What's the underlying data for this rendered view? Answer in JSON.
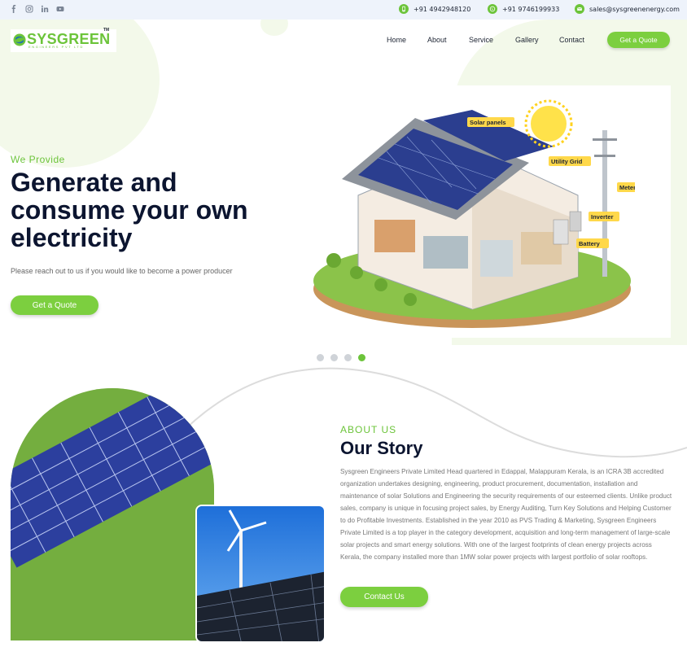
{
  "topbar": {
    "social_icons": [
      "facebook-icon",
      "instagram-icon",
      "linkedin-icon",
      "youtube-icon"
    ],
    "phone": "+91 4942948120",
    "whatsapp": "+91 9746199933",
    "email": "sales@sysgreenenergy.com"
  },
  "logo": {
    "name": "SYSGREEN",
    "tagline": "ENGINEERS PVT LTD",
    "tm": "TM"
  },
  "nav": {
    "items": [
      "Home",
      "About",
      "Service",
      "Gallery",
      "Contact"
    ],
    "cta": "Get a Quote"
  },
  "hero": {
    "eyebrow": "We Provide",
    "title": "Generate and consume your own electricity",
    "subtitle": "Please reach out to us if you would like to become a power producer",
    "cta": "Get a Quote",
    "slide_count": 4,
    "active_slide": 4,
    "illustration_labels": [
      "Solar panels",
      "Utility Grid",
      "Meter",
      "Inverter",
      "Battery"
    ]
  },
  "about": {
    "eyebrow": "ABOUT US",
    "title": "Our Story",
    "body": "Sysgreen Engineers Private Limited Head quartered in Edappal, Malappuram Kerala, is an ICRA 3B accredited organization undertakes designing, engineering, product procurement, documentation, installation and maintenance of solar Solutions and Engineering the security requirements of our esteemed clients. Unlike product sales, company is unique in focusing project sales, by Energy Auditing, Turn Key Solutions and Helping Customer to do Profitable Investments. Established in the year 2010 as PVS Trading & Marketing, Sysgreen Engineers Private Limited is a top player in the category development, acquisition and long-term management of large-scale solar projects and smart energy solutions. With one of the largest footprints of clean energy projects across Kerala, the company installed more than 1MW solar power projects with largest portfolio of solar rooftops.",
    "cta": "Contact Us"
  },
  "colors": {
    "accent": "#6cc43a",
    "button": "#7ccf3f",
    "heading": "#0c1530",
    "topbar_bg": "#eef3fb",
    "blob": "#f3f9ea"
  }
}
